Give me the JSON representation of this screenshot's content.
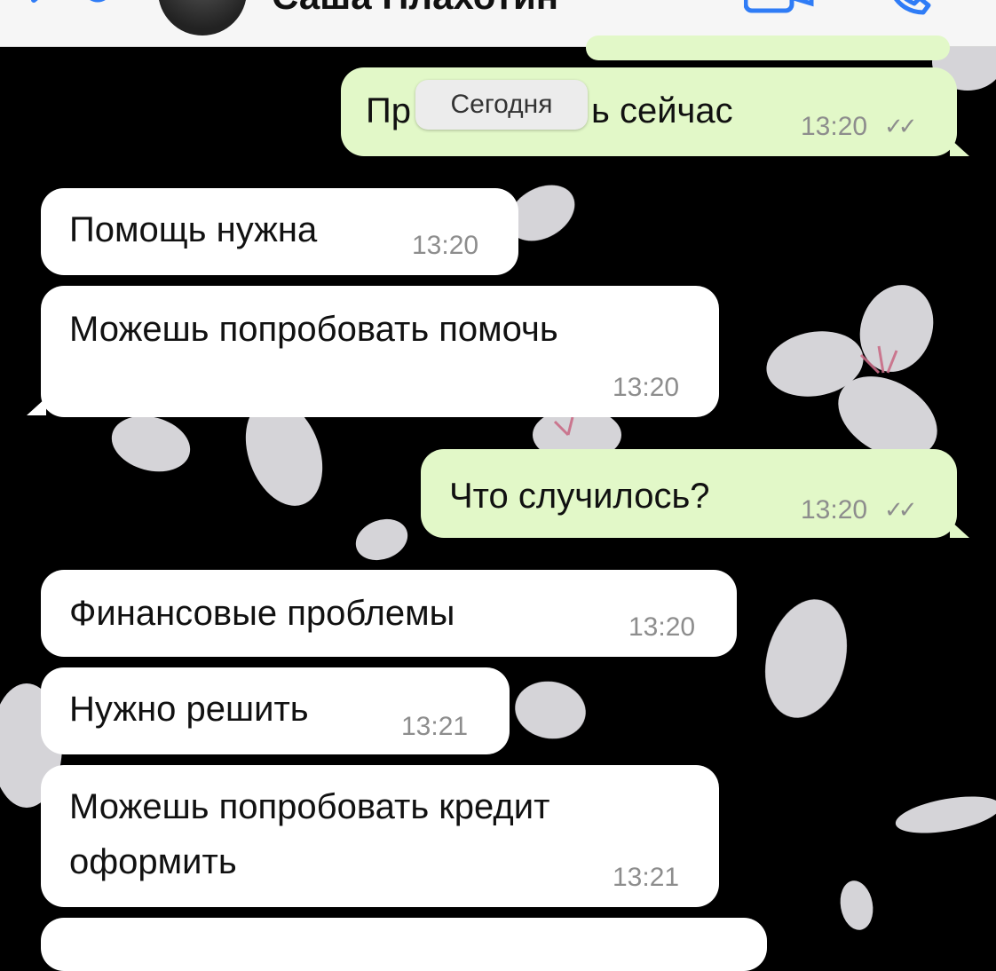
{
  "header": {
    "contact_name": "Саша Плахотин",
    "back_icon": "chevron-left-icon",
    "video_icon": "video-call-icon",
    "phone_icon": "phone-icon"
  },
  "date_separator": "Сегодня",
  "colors": {
    "incoming": "#ffffff",
    "outgoing": "#e2f8c8",
    "background": "#000000"
  },
  "messages": [
    {
      "direction": "out",
      "text": "Пр",
      "text_after": "ь сейчас",
      "time": "13:20",
      "read": true
    },
    {
      "direction": "in",
      "text": "Помощь нужна",
      "time": "13:20"
    },
    {
      "direction": "in",
      "text": "Можешь попробовать помочь",
      "time": "13:20"
    },
    {
      "direction": "out",
      "text": "Что случилось?",
      "time": "13:20",
      "read": true
    },
    {
      "direction": "in",
      "text": "Финансовые проблемы",
      "time": "13:20"
    },
    {
      "direction": "in",
      "text": "Нужно решить",
      "time": "13:21"
    },
    {
      "direction": "in",
      "text": "Можешь попробовать кредит",
      "text_line2": "оформить",
      "time": "13:21"
    }
  ]
}
